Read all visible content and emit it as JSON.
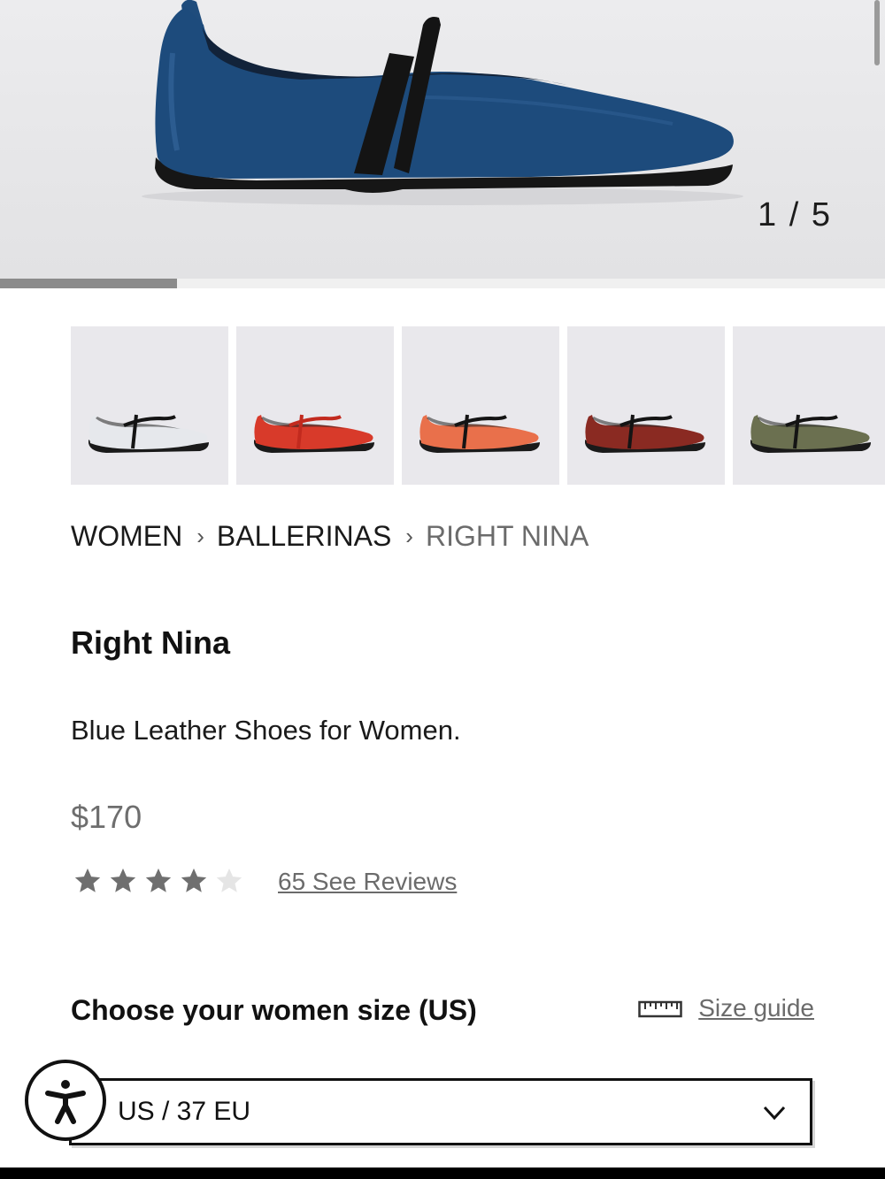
{
  "gallery": {
    "counter": "1 / 5",
    "progress": 0.2,
    "image_alt": "Blue leather ballerina shoe with black elastic strap"
  },
  "variants": [
    {
      "color": "#e6e8ec",
      "strap": "#141414",
      "name": "white"
    },
    {
      "color": "#d83a2a",
      "strap": "#c22a1e",
      "name": "red"
    },
    {
      "color": "#e9704b",
      "strap": "#141414",
      "name": "orange"
    },
    {
      "color": "#8a2a22",
      "strap": "#141414",
      "name": "burgundy"
    },
    {
      "color": "#6b7050",
      "strap": "#141414",
      "name": "olive"
    }
  ],
  "breadcrumb": {
    "items": [
      "WOMEN",
      "BALLERINAS",
      "RIGHT NINA"
    ]
  },
  "product": {
    "title": "Right Nina",
    "description": "Blue Leather Shoes for Women.",
    "price": "$170",
    "rating": 4,
    "rating_max": 5,
    "reviews_label": "65 See Reviews"
  },
  "size": {
    "heading": "Choose your women size (US)",
    "guide_label": "Size guide",
    "selected": "US / 37 EU"
  },
  "colors": {
    "star_filled": "#6f6f6f",
    "star_empty": "#e5e5e5",
    "shoe_blue": "#1d4b7c"
  }
}
